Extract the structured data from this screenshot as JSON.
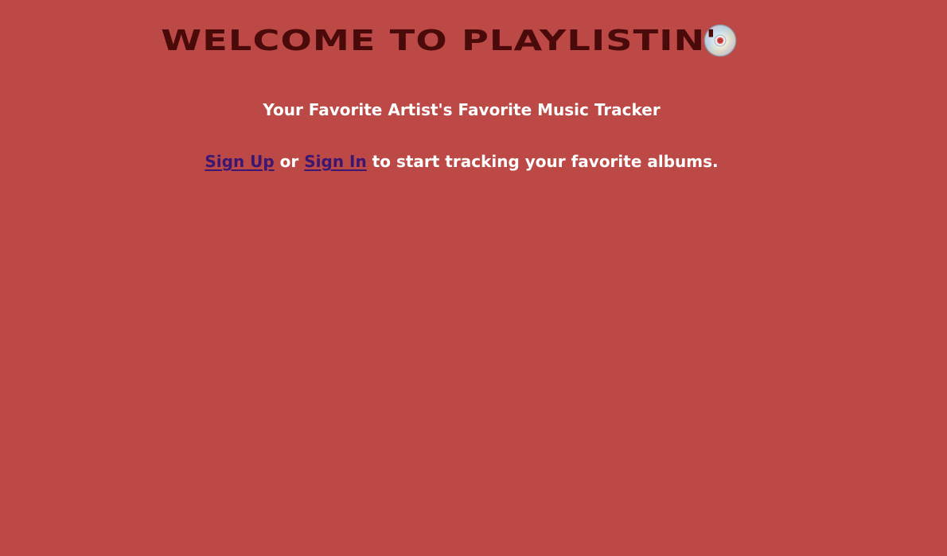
{
  "header": {
    "title": "WELCOME TO PLAYLISTIN'",
    "icon": "cd-disc-icon"
  },
  "tagline": "Your Favorite Artist's Favorite Music Tracker",
  "cta": {
    "sign_up_label": "Sign Up",
    "or_text": " or ",
    "sign_in_label": "Sign In",
    "trailing_text": " to start tracking your favorite albums."
  },
  "colors": {
    "background": "#bc4945",
    "title": "#4a0a0a",
    "text": "#ffffff",
    "link": "#3b1772"
  }
}
